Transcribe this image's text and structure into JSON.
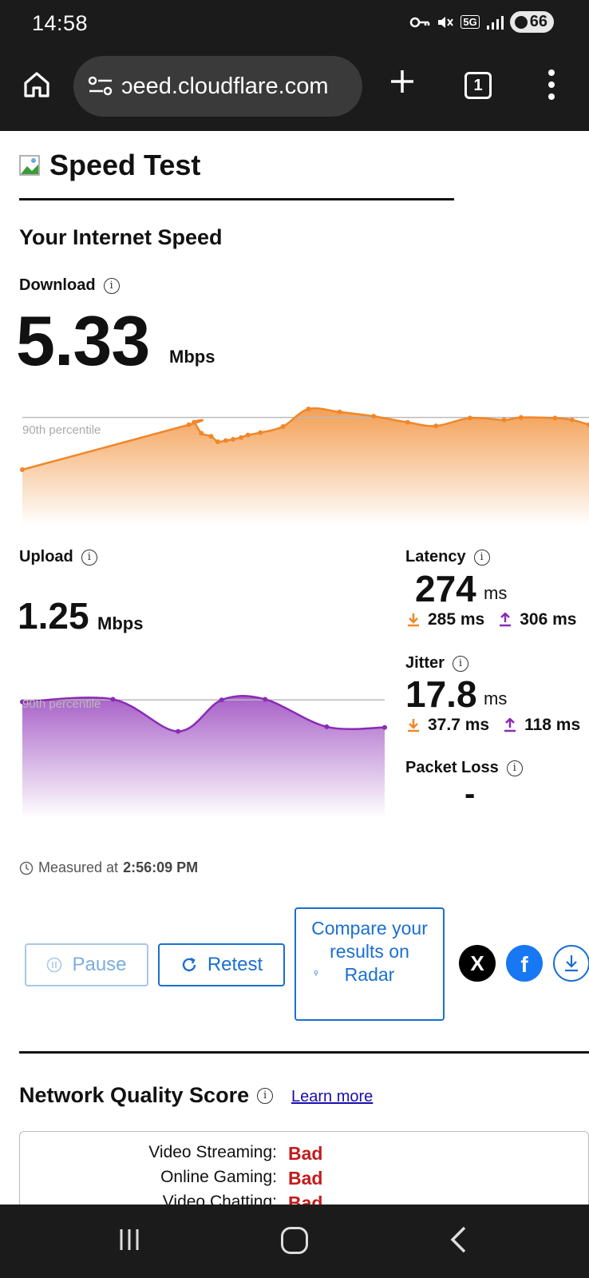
{
  "status_bar": {
    "time": "14:58",
    "battery": "66",
    "network": "5G",
    "icons": [
      "vpn-key-icon",
      "mute-icon",
      "5g-icon",
      "signal-icon",
      "battery-icon"
    ]
  },
  "browser": {
    "url": "ɔeed.cloudflare.com",
    "tab_count": "1",
    "icons": [
      "home-icon",
      "site-settings-icon",
      "plus-icon",
      "tabs-icon",
      "menu-icon"
    ]
  },
  "page": {
    "brand_title": "Speed Test",
    "section_title": "Your Internet Speed",
    "download": {
      "label": "Download",
      "info": "i",
      "value": "5.33",
      "unit": "Mbps",
      "percentile_label": "90th percentile"
    },
    "upload": {
      "label": "Upload",
      "info": "i",
      "value": "1.25",
      "unit": "Mbps",
      "percentile_label": "90th percentile"
    },
    "latency": {
      "label": "Latency",
      "info": "i",
      "value": "274",
      "unit": "ms",
      "down": "285 ms",
      "up": "306 ms"
    },
    "jitter": {
      "label": "Jitter",
      "info": "i",
      "value": "17.8",
      "unit": "ms",
      "down": "37.7 ms",
      "up": "118 ms"
    },
    "packet_loss": {
      "label": "Packet Loss",
      "info": "i",
      "value": "-"
    },
    "measured": {
      "prefix": "Measured at",
      "time": "2:56:09 PM"
    },
    "buttons": {
      "pause": "Pause",
      "retest": "Retest",
      "compare": "Compare your results on Radar",
      "share_x": "X",
      "share_facebook": "f"
    },
    "network_quality": {
      "title": "Network Quality Score",
      "info": "i",
      "learn_more": "Learn more",
      "rows": [
        {
          "label": "Video Streaming:",
          "value": "Bad"
        },
        {
          "label": "Online Gaming:",
          "value": "Bad"
        },
        {
          "label": "Video Chatting:",
          "value": "Bad"
        }
      ]
    },
    "colors": {
      "download": "#f0872a",
      "upload": "#8a2bb5",
      "link": "#1a6fd0",
      "bad": "#c21c1c"
    }
  },
  "chart_data": [
    {
      "type": "area",
      "name": "download",
      "values": [
        0.0,
        0.74,
        0.78,
        0.6,
        0.55,
        0.46,
        0.48,
        0.5,
        0.53,
        0.57,
        0.61,
        0.71,
        1.0,
        0.95,
        0.88,
        0.78,
        0.72,
        0.85,
        0.82,
        0.86,
        0.85,
        0.82,
        0.74
      ],
      "x": [
        0,
        0.294,
        0.303,
        0.316,
        0.333,
        0.345,
        0.359,
        0.372,
        0.386,
        0.398,
        0.42,
        0.46,
        0.505,
        0.56,
        0.62,
        0.68,
        0.73,
        0.79,
        0.85,
        0.88,
        0.94,
        0.97,
        1.0
      ],
      "percentile_90": 0.86
    },
    {
      "type": "area",
      "name": "upload",
      "x": [
        0,
        0.25,
        0.43,
        0.55,
        0.67,
        0.84,
        1.0
      ],
      "values": [
        0.82,
        0.86,
        0.37,
        0.85,
        0.86,
        0.44,
        0.43
      ],
      "percentile_90": 0.85
    }
  ]
}
